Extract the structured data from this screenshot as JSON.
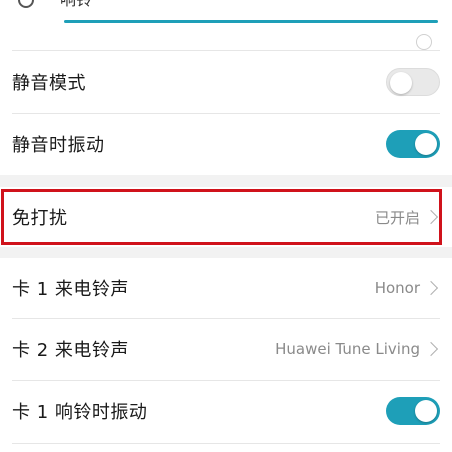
{
  "slider": {
    "label": "响铃",
    "level": 1.0,
    "accent": "#1e9fb8"
  },
  "rows": {
    "silent_mode": {
      "label": "静音模式",
      "toggle": "off"
    },
    "vibrate_silent": {
      "label": "静音时振动",
      "toggle": "on"
    },
    "dnd": {
      "label": "免打扰",
      "value": "已开启"
    },
    "sim1_ringtone": {
      "label": "卡 1 来电铃声",
      "value": "Honor"
    },
    "sim2_ringtone": {
      "label": "卡 2 来电铃声",
      "value": "Huawei Tune Living"
    },
    "sim1_vibrate": {
      "label": "卡 1 响铃时振动",
      "toggle": "on"
    }
  },
  "colors": {
    "accent": "#1e9fb8",
    "highlight": "#d0121b",
    "background": "#f2f2f2"
  }
}
